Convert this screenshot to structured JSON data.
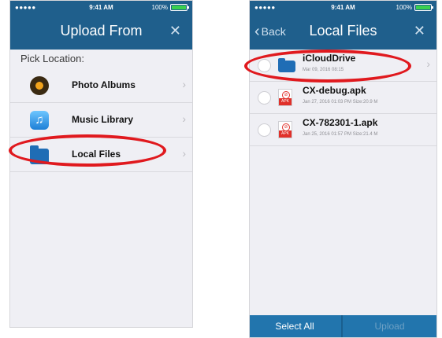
{
  "status_bar": {
    "signal": "●●●●● ",
    "time": "9:41 AM",
    "battery": "100%",
    "battery_level": 1.0
  },
  "left_screen": {
    "title": "Upload From",
    "close_icon": "close-icon",
    "section_label": "Pick Location:",
    "locations": [
      {
        "label": "Photo Albums",
        "icon": "photo-albums-icon",
        "chevron": "›"
      },
      {
        "label": "Music Library",
        "icon": "music-note-icon",
        "chevron": "›"
      },
      {
        "label": "Local Files",
        "icon": "folder-icon",
        "chevron": "›"
      }
    ]
  },
  "right_screen": {
    "back_label": "Back",
    "title": "Local Files",
    "close_icon": "close-icon",
    "files": [
      {
        "name": "iCloudDrive",
        "meta": "Mar 09, 2016 08:15",
        "icon": "folder-icon",
        "chevron": "›"
      },
      {
        "name": "CX-debug.apk",
        "meta": "Jan 27, 2016 01:03 PM  Size:20.9 M",
        "icon": "apk-file-icon"
      },
      {
        "name": "CX-782301-1.apk",
        "meta": "Jan 25, 2016 01:57 PM  Size:21.4 M",
        "icon": "apk-file-icon"
      }
    ],
    "bottom_bar": {
      "select_all": "Select All",
      "upload": "Upload"
    }
  },
  "colors": {
    "nav_bar": "#1f5f8c",
    "bottom_bar": "#2275ad",
    "annotation_oval": "#e0191e",
    "folder_blue": "#1f6db5",
    "apk_red": "#e0302a"
  }
}
